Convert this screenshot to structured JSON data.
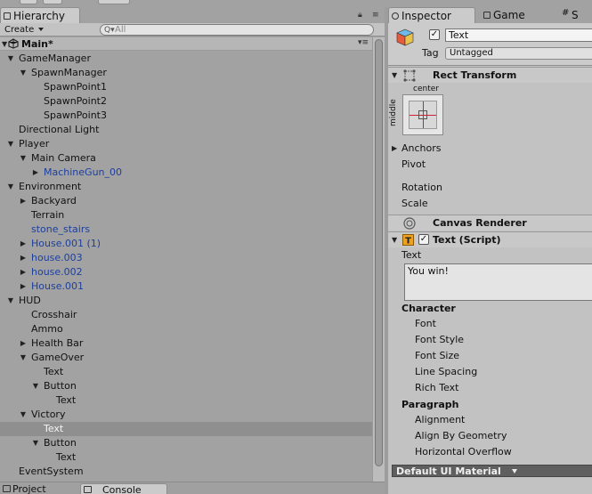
{
  "hierarchy": {
    "tab_label": "Hierarchy",
    "create_label": "Create",
    "search_placeholder": "All",
    "scene_name": "Main*",
    "tree": [
      {
        "label": "GameManager",
        "depth": 0,
        "fold": "open"
      },
      {
        "label": "SpawnManager",
        "depth": 1,
        "fold": "open"
      },
      {
        "label": "SpawnPoint1",
        "depth": 2,
        "fold": "none"
      },
      {
        "label": "SpawnPoint2",
        "depth": 2,
        "fold": "none"
      },
      {
        "label": "SpawnPoint3",
        "depth": 2,
        "fold": "none"
      },
      {
        "label": "Directional Light",
        "depth": 0,
        "fold": "none"
      },
      {
        "label": "Player",
        "depth": 0,
        "fold": "open"
      },
      {
        "label": "Main Camera",
        "depth": 1,
        "fold": "open"
      },
      {
        "label": "MachineGun_00",
        "depth": 2,
        "fold": "closed",
        "prefab": true
      },
      {
        "label": "Environment",
        "depth": 0,
        "fold": "open"
      },
      {
        "label": "Backyard",
        "depth": 1,
        "fold": "closed"
      },
      {
        "label": "Terrain",
        "depth": 1,
        "fold": "none"
      },
      {
        "label": "stone_stairs",
        "depth": 1,
        "fold": "none",
        "prefab": true
      },
      {
        "label": "House.001 (1)",
        "depth": 1,
        "fold": "closed",
        "prefab": true
      },
      {
        "label": "house.003",
        "depth": 1,
        "fold": "closed",
        "prefab": true
      },
      {
        "label": "house.002",
        "depth": 1,
        "fold": "closed",
        "prefab": true
      },
      {
        "label": "House.001",
        "depth": 1,
        "fold": "closed",
        "prefab": true
      },
      {
        "label": "HUD",
        "depth": 0,
        "fold": "open"
      },
      {
        "label": "Crosshair",
        "depth": 1,
        "fold": "none"
      },
      {
        "label": "Ammo",
        "depth": 1,
        "fold": "none"
      },
      {
        "label": "Health Bar",
        "depth": 1,
        "fold": "closed"
      },
      {
        "label": "GameOver",
        "depth": 1,
        "fold": "open"
      },
      {
        "label": "Text",
        "depth": 2,
        "fold": "none"
      },
      {
        "label": "Button",
        "depth": 2,
        "fold": "open"
      },
      {
        "label": "Text",
        "depth": 3,
        "fold": "none"
      },
      {
        "label": "Victory",
        "depth": 1,
        "fold": "open"
      },
      {
        "label": "Text",
        "depth": 2,
        "fold": "none",
        "selected": true
      },
      {
        "label": "Button",
        "depth": 2,
        "fold": "open"
      },
      {
        "label": "Text",
        "depth": 3,
        "fold": "none"
      },
      {
        "label": "EventSystem",
        "depth": 0,
        "fold": "none"
      }
    ]
  },
  "bottom_tabs": {
    "project": "Project",
    "console": "Console"
  },
  "inspector": {
    "tab_label": "Inspector",
    "game_tab": "Game",
    "extra_tab": "S",
    "object_name": "Text",
    "tag_label": "Tag",
    "tag_value": "Untagged",
    "rect_transform": {
      "title": "Rect Transform",
      "anchor_h": "center",
      "anchor_v": "middle",
      "props": [
        "Anchors",
        "Pivot",
        "Rotation",
        "Scale"
      ]
    },
    "canvas_renderer": {
      "title": "Canvas Renderer"
    },
    "text_script": {
      "title": "Text (Script)",
      "text_label": "Text",
      "text_value": "You win!",
      "character_section": "Character",
      "character_props": [
        "Font",
        "Font Style",
        "Font Size",
        "Line Spacing",
        "Rich Text"
      ],
      "paragraph_section": "Paragraph",
      "paragraph_props": [
        "Alignment",
        "Align By Geometry",
        "Horizontal Overflow"
      ]
    },
    "material": "Default UI Material"
  },
  "colors": {
    "prefab_text": "#1e3f9c",
    "selection": "#8f8f8f",
    "panel_bg": "#c2c2c2"
  }
}
